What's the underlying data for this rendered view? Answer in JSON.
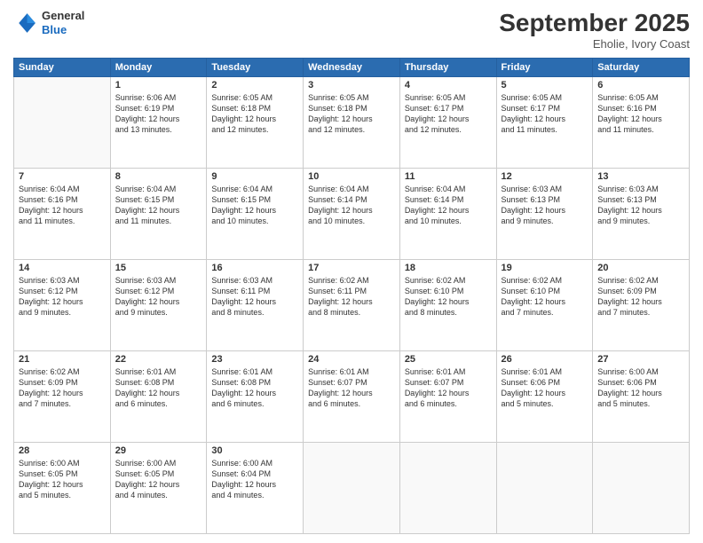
{
  "header": {
    "logo_line1": "General",
    "logo_line2": "Blue",
    "month_title": "September 2025",
    "location": "Eholie, Ivory Coast"
  },
  "days_of_week": [
    "Sunday",
    "Monday",
    "Tuesday",
    "Wednesday",
    "Thursday",
    "Friday",
    "Saturday"
  ],
  "weeks": [
    [
      {
        "day": "",
        "info": ""
      },
      {
        "day": "1",
        "info": "Sunrise: 6:06 AM\nSunset: 6:19 PM\nDaylight: 12 hours\nand 13 minutes."
      },
      {
        "day": "2",
        "info": "Sunrise: 6:05 AM\nSunset: 6:18 PM\nDaylight: 12 hours\nand 12 minutes."
      },
      {
        "day": "3",
        "info": "Sunrise: 6:05 AM\nSunset: 6:18 PM\nDaylight: 12 hours\nand 12 minutes."
      },
      {
        "day": "4",
        "info": "Sunrise: 6:05 AM\nSunset: 6:17 PM\nDaylight: 12 hours\nand 12 minutes."
      },
      {
        "day": "5",
        "info": "Sunrise: 6:05 AM\nSunset: 6:17 PM\nDaylight: 12 hours\nand 11 minutes."
      },
      {
        "day": "6",
        "info": "Sunrise: 6:05 AM\nSunset: 6:16 PM\nDaylight: 12 hours\nand 11 minutes."
      }
    ],
    [
      {
        "day": "7",
        "info": "Sunrise: 6:04 AM\nSunset: 6:16 PM\nDaylight: 12 hours\nand 11 minutes."
      },
      {
        "day": "8",
        "info": "Sunrise: 6:04 AM\nSunset: 6:15 PM\nDaylight: 12 hours\nand 11 minutes."
      },
      {
        "day": "9",
        "info": "Sunrise: 6:04 AM\nSunset: 6:15 PM\nDaylight: 12 hours\nand 10 minutes."
      },
      {
        "day": "10",
        "info": "Sunrise: 6:04 AM\nSunset: 6:14 PM\nDaylight: 12 hours\nand 10 minutes."
      },
      {
        "day": "11",
        "info": "Sunrise: 6:04 AM\nSunset: 6:14 PM\nDaylight: 12 hours\nand 10 minutes."
      },
      {
        "day": "12",
        "info": "Sunrise: 6:03 AM\nSunset: 6:13 PM\nDaylight: 12 hours\nand 9 minutes."
      },
      {
        "day": "13",
        "info": "Sunrise: 6:03 AM\nSunset: 6:13 PM\nDaylight: 12 hours\nand 9 minutes."
      }
    ],
    [
      {
        "day": "14",
        "info": "Sunrise: 6:03 AM\nSunset: 6:12 PM\nDaylight: 12 hours\nand 9 minutes."
      },
      {
        "day": "15",
        "info": "Sunrise: 6:03 AM\nSunset: 6:12 PM\nDaylight: 12 hours\nand 9 minutes."
      },
      {
        "day": "16",
        "info": "Sunrise: 6:03 AM\nSunset: 6:11 PM\nDaylight: 12 hours\nand 8 minutes."
      },
      {
        "day": "17",
        "info": "Sunrise: 6:02 AM\nSunset: 6:11 PM\nDaylight: 12 hours\nand 8 minutes."
      },
      {
        "day": "18",
        "info": "Sunrise: 6:02 AM\nSunset: 6:10 PM\nDaylight: 12 hours\nand 8 minutes."
      },
      {
        "day": "19",
        "info": "Sunrise: 6:02 AM\nSunset: 6:10 PM\nDaylight: 12 hours\nand 7 minutes."
      },
      {
        "day": "20",
        "info": "Sunrise: 6:02 AM\nSunset: 6:09 PM\nDaylight: 12 hours\nand 7 minutes."
      }
    ],
    [
      {
        "day": "21",
        "info": "Sunrise: 6:02 AM\nSunset: 6:09 PM\nDaylight: 12 hours\nand 7 minutes."
      },
      {
        "day": "22",
        "info": "Sunrise: 6:01 AM\nSunset: 6:08 PM\nDaylight: 12 hours\nand 6 minutes."
      },
      {
        "day": "23",
        "info": "Sunrise: 6:01 AM\nSunset: 6:08 PM\nDaylight: 12 hours\nand 6 minutes."
      },
      {
        "day": "24",
        "info": "Sunrise: 6:01 AM\nSunset: 6:07 PM\nDaylight: 12 hours\nand 6 minutes."
      },
      {
        "day": "25",
        "info": "Sunrise: 6:01 AM\nSunset: 6:07 PM\nDaylight: 12 hours\nand 6 minutes."
      },
      {
        "day": "26",
        "info": "Sunrise: 6:01 AM\nSunset: 6:06 PM\nDaylight: 12 hours\nand 5 minutes."
      },
      {
        "day": "27",
        "info": "Sunrise: 6:00 AM\nSunset: 6:06 PM\nDaylight: 12 hours\nand 5 minutes."
      }
    ],
    [
      {
        "day": "28",
        "info": "Sunrise: 6:00 AM\nSunset: 6:05 PM\nDaylight: 12 hours\nand 5 minutes."
      },
      {
        "day": "29",
        "info": "Sunrise: 6:00 AM\nSunset: 6:05 PM\nDaylight: 12 hours\nand 4 minutes."
      },
      {
        "day": "30",
        "info": "Sunrise: 6:00 AM\nSunset: 6:04 PM\nDaylight: 12 hours\nand 4 minutes."
      },
      {
        "day": "",
        "info": ""
      },
      {
        "day": "",
        "info": ""
      },
      {
        "day": "",
        "info": ""
      },
      {
        "day": "",
        "info": ""
      }
    ]
  ]
}
